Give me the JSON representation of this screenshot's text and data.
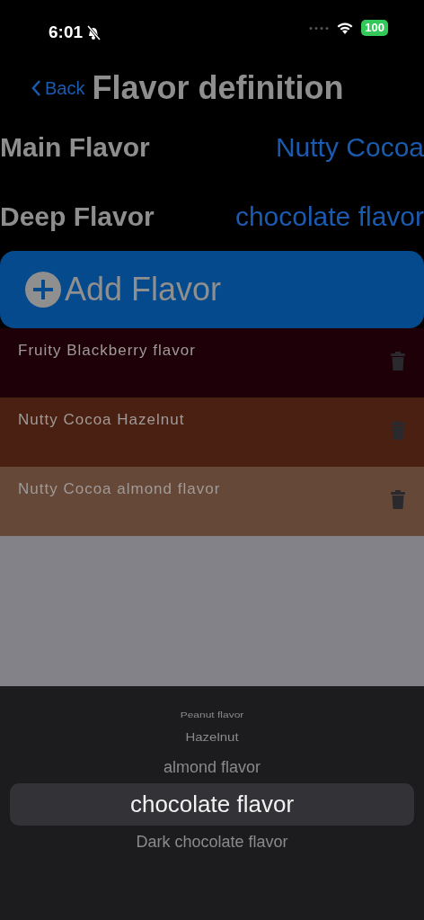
{
  "status_bar": {
    "time": "6:01",
    "battery": "100"
  },
  "nav": {
    "back": "Back",
    "title": "Flavor definition"
  },
  "fields": [
    {
      "label": "Main Flavor",
      "value": "Nutty Cocoa"
    },
    {
      "label": "Deep Flavor",
      "value": "chocolate flavor"
    }
  ],
  "add_button": {
    "label": "Add Flavor"
  },
  "flavors": [
    {
      "name": "Fruity Blackberry flavor",
      "color": "#1e0008"
    },
    {
      "name": "Nutty Cocoa Hazelnut",
      "color": "#4a2012"
    },
    {
      "name": "Nutty Cocoa almond flavor",
      "color": "#654838"
    }
  ],
  "picker": {
    "items": [
      {
        "label": "Peanut flavor",
        "selected": false
      },
      {
        "label": "Hazelnut",
        "selected": false
      },
      {
        "label": "almond flavor",
        "selected": false
      },
      {
        "label": "chocolate flavor",
        "selected": true
      },
      {
        "label": "Dark chocolate flavor",
        "selected": false
      }
    ]
  }
}
